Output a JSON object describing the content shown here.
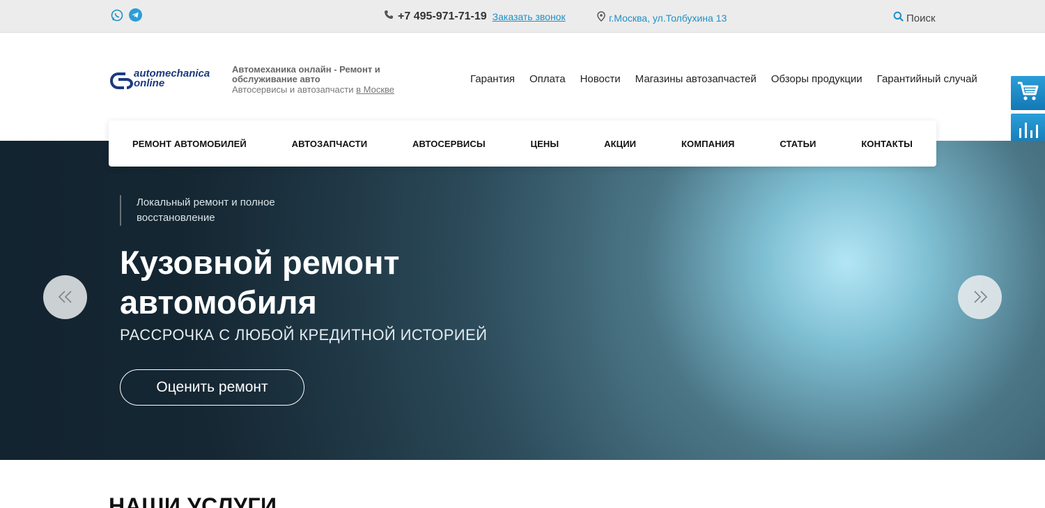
{
  "topbar": {
    "phone": "+7 495-971-71-19",
    "callback": "Заказать звонок",
    "address": "г.Москва, ул.Толбухина 13",
    "search": "Поиск"
  },
  "header": {
    "logo_line1": "automechanica",
    "logo_line2": "online",
    "tagline_title": "Автомеханика онлайн - Ремонт и обслуживание авто",
    "tagline_sub": "Автосервисы и автозапчасти",
    "tagline_link": "в Москве",
    "nav": [
      "Гарантия",
      "Оплата",
      "Новости",
      "Магазины автозапчастей",
      "Обзоры продукции",
      "Гарантийный случай"
    ]
  },
  "main_nav": [
    "РЕМОНТ АВТОМОБИЛЕЙ",
    "АВТОЗАПЧАСТИ",
    "АВТОСЕРВИСЫ",
    "ЦЕНЫ",
    "АКЦИИ",
    "КОМПАНИЯ",
    "СТАТЬИ",
    "КОНТАКТЫ"
  ],
  "hero": {
    "pre_title": "Локальный ремонт и полное восстановление",
    "title": "Кузовной ремонт автомобиля",
    "subtitle": "РАССРОЧКА С ЛЮБОЙ КРЕДИТНОЙ ИСТОРИЕЙ",
    "button": "Оценить ремонт",
    "prev": "<<",
    "next": ">>"
  },
  "section": {
    "title": "НАШИ УСЛУГИ"
  },
  "side_buttons": [
    "cart-icon",
    "compare-icon",
    "favorite-icon"
  ],
  "colors": {
    "accent": "#1f8fc5",
    "side_button": "#1a86c4",
    "logo": "#1d3a7d"
  }
}
